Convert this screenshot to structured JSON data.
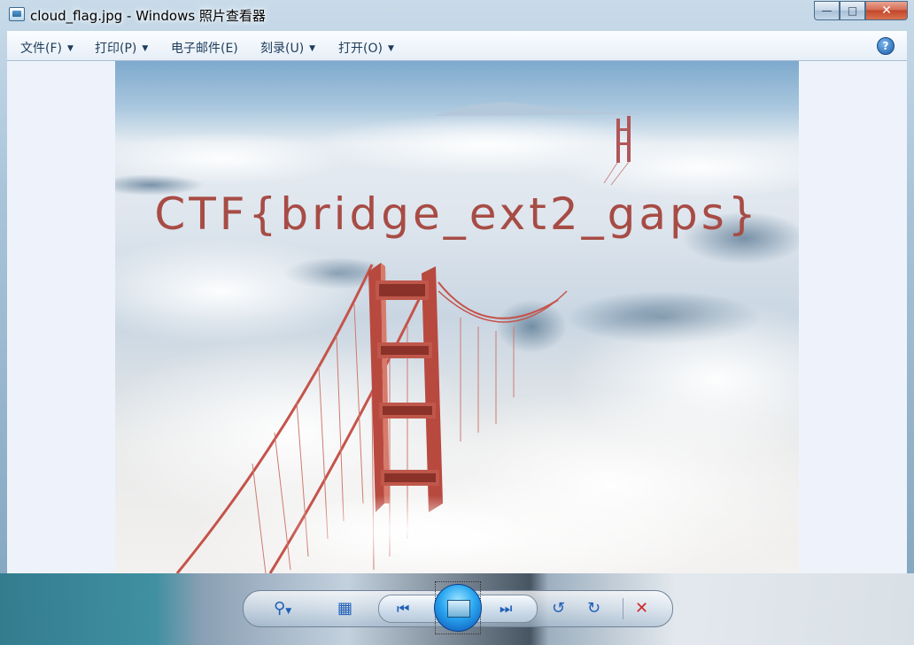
{
  "window": {
    "title": "cloud_flag.jpg - Windows 照片查看器"
  },
  "menu": {
    "file": "文件(F)",
    "print": "打印(P)",
    "email": "电子邮件(E)",
    "burn": "刻录(U)",
    "open": "打开(O)",
    "help": "?"
  },
  "photo": {
    "overlay_text": "CTF{bridge_ext2_gaps}",
    "overlay_color": "#a74c45"
  },
  "toolbar": {
    "icons": [
      "zoom-icon",
      "fit-window-icon",
      "previous-icon",
      "slideshow-icon",
      "next-icon",
      "rotate-left-icon",
      "rotate-right-icon",
      "delete-icon"
    ]
  },
  "colors": {
    "accent": "#1f5fb6",
    "delete": "#d0282a",
    "close_button": "#c2462b"
  }
}
